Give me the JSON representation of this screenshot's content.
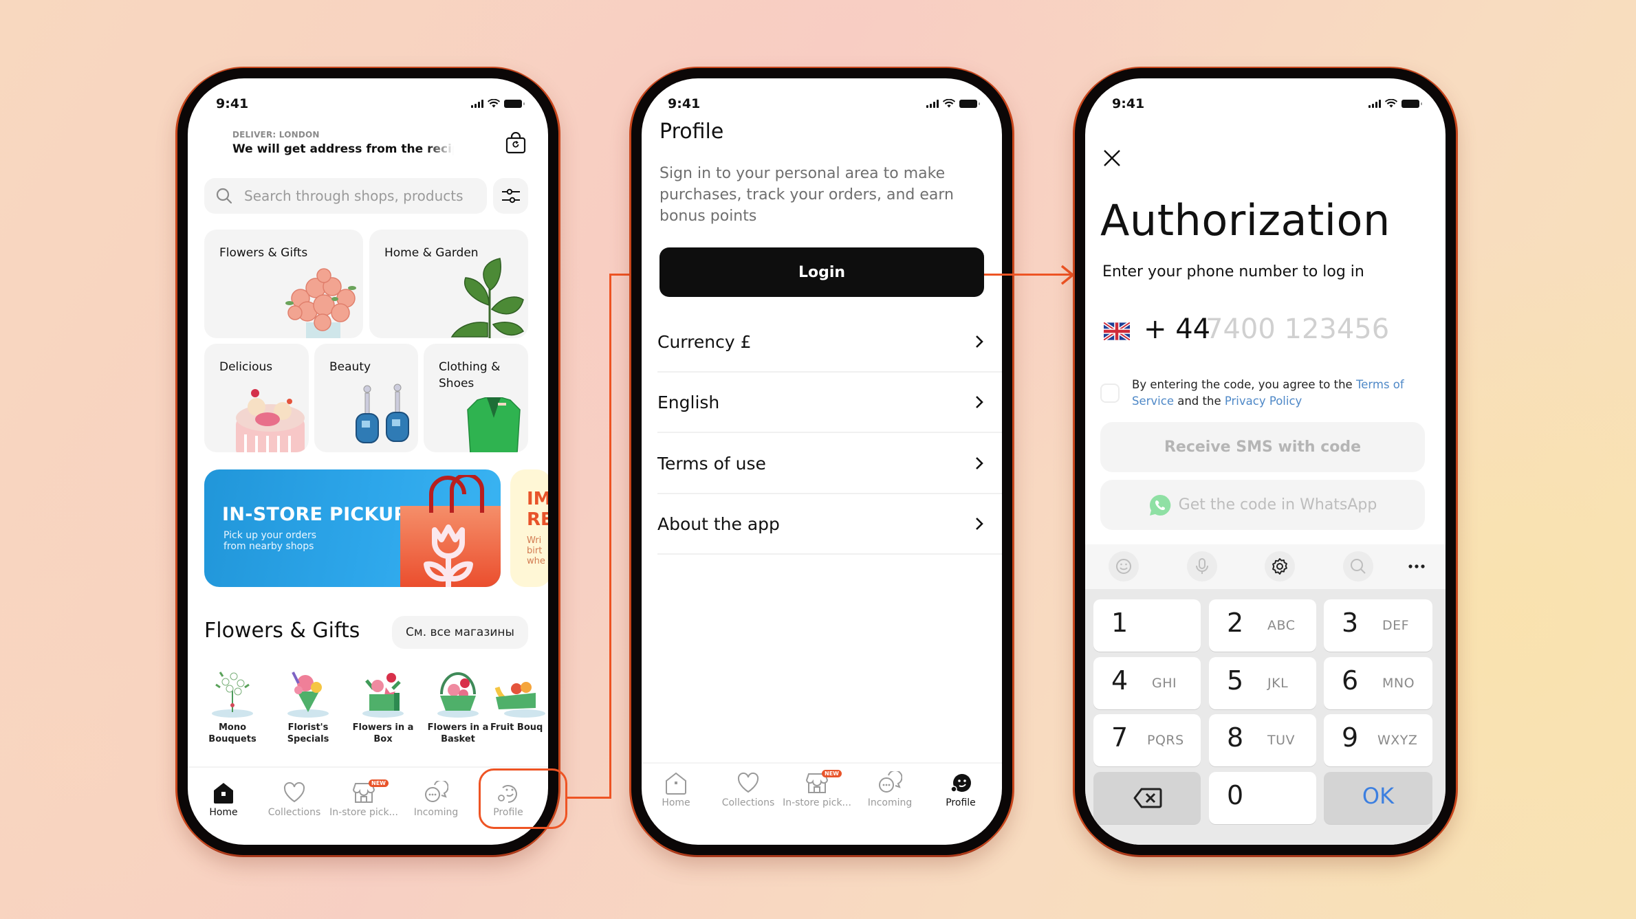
{
  "colors": {
    "accent": "#ee5424",
    "login_button": "#0e0e0e",
    "link": "#4e88c7",
    "ok_key": "#3c7fe0",
    "whatsapp": "#4ccf6a",
    "banner_blue": "#2196d9",
    "badge_new": "#e8542a"
  },
  "status_bar": {
    "time": "9:41"
  },
  "home_screen": {
    "deliver_label": "DELIVER: LONDON",
    "address": "We will get address from the recipient",
    "cart_icon": "shopping-bag-icon",
    "search": {
      "placeholder": "Search through shops, products",
      "icon": "search-icon"
    },
    "filter_icon": "sliders-icon",
    "categories": [
      {
        "label": "Flowers & Gifts",
        "image": "rose-bouquet"
      },
      {
        "label": "Home & Garden",
        "image": "ficus-plant"
      },
      {
        "label": "Delicious",
        "image": "cake"
      },
      {
        "label": "Beauty",
        "image": "blue-earrings"
      },
      {
        "label": "Clothing & Shoes",
        "image": "green-blazer"
      }
    ],
    "banners": [
      {
        "title": "IN-STORE PICKUP",
        "subtitle": "Pick up your orders from nearby shops"
      },
      {
        "title": "IM RE",
        "subtitle": "Wri birt whe"
      }
    ],
    "section": {
      "title": "Flowers & Gifts",
      "all_shops_button": "См. все магазины",
      "subcategories": [
        {
          "label": "Mono Bouquets"
        },
        {
          "label": "Florist's Specials"
        },
        {
          "label": "Flowers in a Box"
        },
        {
          "label": "Flowers in a Basket"
        },
        {
          "label": "Fruit Bouq"
        }
      ]
    },
    "nav": [
      {
        "label": "Home",
        "icon": "home-icon",
        "active": true
      },
      {
        "label": "Collections",
        "icon": "heart-icon"
      },
      {
        "label": "In-store pick...",
        "icon": "store-icon",
        "badge": "NEW"
      },
      {
        "label": "Incoming",
        "icon": "chat-bubbles-icon"
      },
      {
        "label": "Profile",
        "icon": "profile-face-icon",
        "highlighted": true
      }
    ]
  },
  "profile_screen": {
    "title": "Profile",
    "description": "Sign in to your personal area to make purchases, track your orders, and earn bonus points",
    "login_button": "Login",
    "list": [
      {
        "label": "Currency £"
      },
      {
        "label": "English"
      },
      {
        "label": "Terms of use"
      },
      {
        "label": "About the app"
      }
    ],
    "nav": [
      {
        "label": "Home",
        "icon": "home-icon"
      },
      {
        "label": "Collections",
        "icon": "heart-icon"
      },
      {
        "label": "In-store pick...",
        "icon": "store-icon",
        "badge": "NEW"
      },
      {
        "label": "Incoming",
        "icon": "chat-bubbles-icon"
      },
      {
        "label": "Profile",
        "icon": "profile-face-icon",
        "active": true
      }
    ]
  },
  "auth_screen": {
    "title": "Authorization",
    "subtitle": "Enter your phone number to log in",
    "country_flag": "uk-flag-icon",
    "country_code": "+ 44",
    "phone_placeholder": "7400 123456",
    "terms_prefix": "By entering the code, you agree to the ",
    "terms_link": "Terms of Service",
    "terms_mid": " and the ",
    "privacy_link": "Privacy Policy",
    "terms_checked": false,
    "sms_button": "Receive SMS with code",
    "whatsapp_button": "Get the code in WhatsApp",
    "keyboard": {
      "toolbar": [
        "emoji-icon",
        "microphone-icon",
        "settings-gear-icon",
        "search-icon",
        "more-dots-icon"
      ],
      "keys": [
        {
          "num": "1",
          "letters": ""
        },
        {
          "num": "2",
          "letters": "ABC"
        },
        {
          "num": "3",
          "letters": "DEF"
        },
        {
          "num": "4",
          "letters": "GHI"
        },
        {
          "num": "5",
          "letters": "JKL"
        },
        {
          "num": "6",
          "letters": "MNO"
        },
        {
          "num": "7",
          "letters": "PQRS"
        },
        {
          "num": "8",
          "letters": "TUV"
        },
        {
          "num": "9",
          "letters": "WXYZ"
        }
      ],
      "zero": "0",
      "ok": "OK",
      "backspace_icon": "backspace-icon"
    }
  }
}
